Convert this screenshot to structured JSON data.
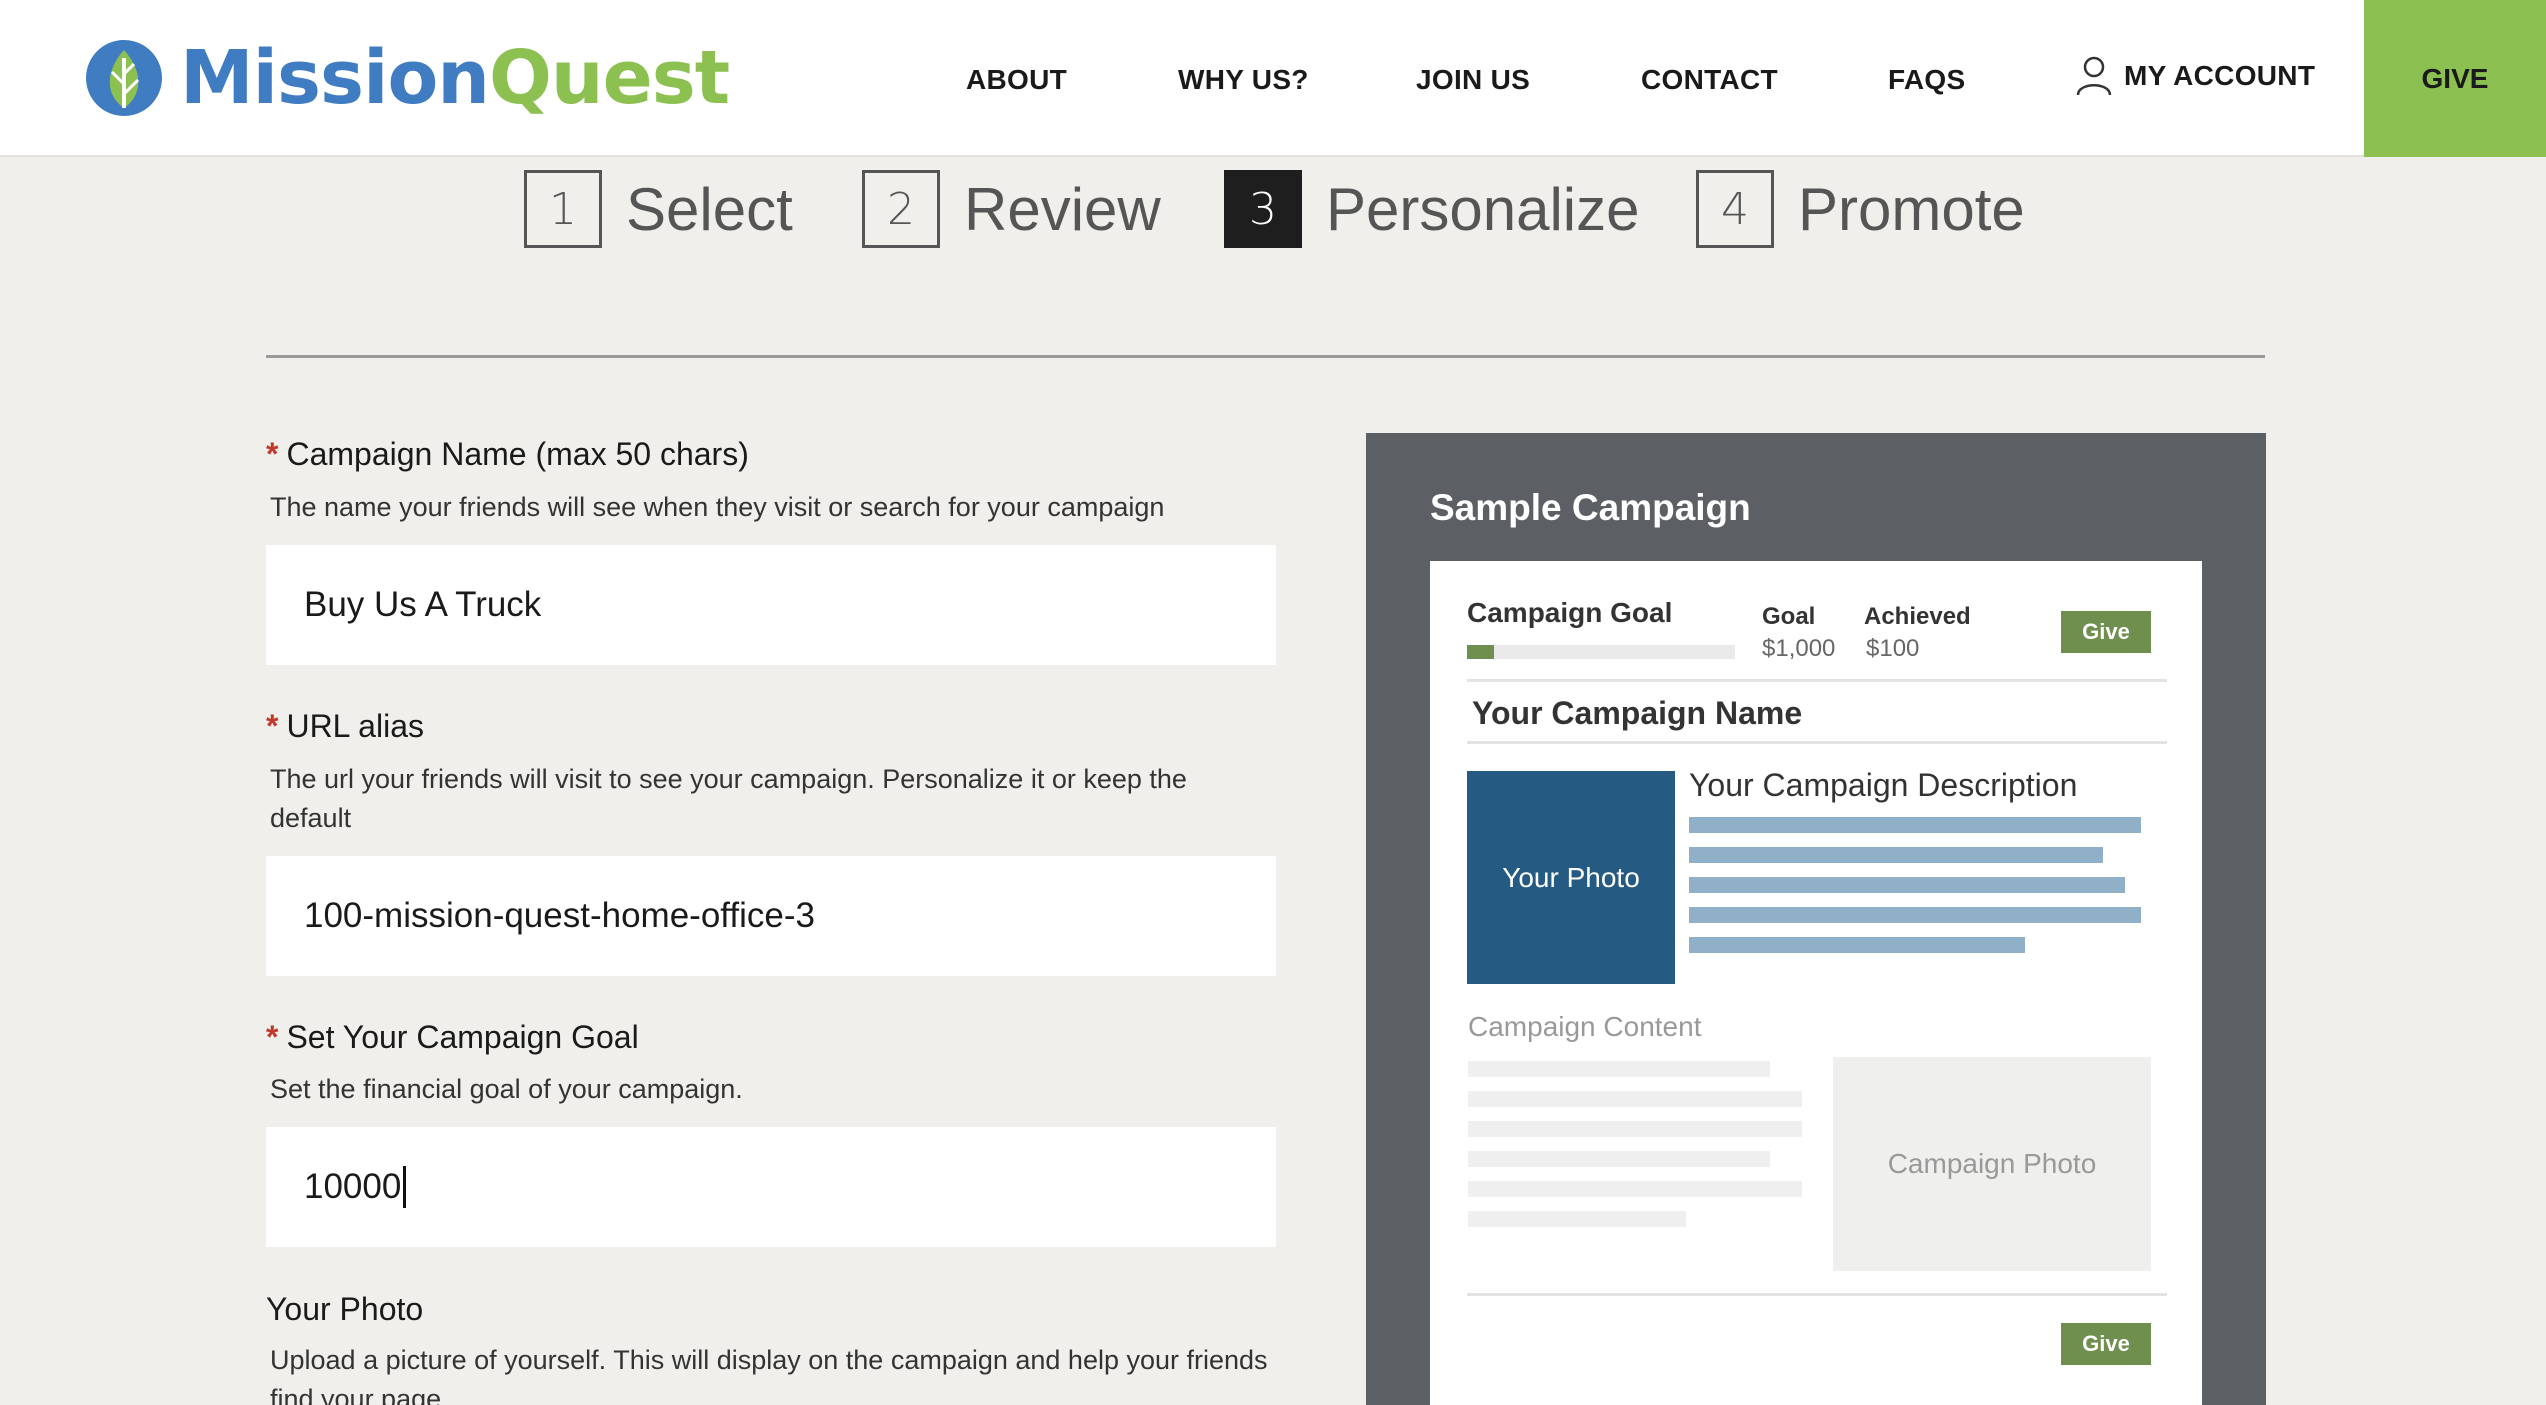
{
  "brand": {
    "part1": "Mission",
    "part2": "Quest",
    "colors": {
      "blue": "#3f7cc1",
      "green": "#8cc152"
    }
  },
  "nav": {
    "about": "ABOUT",
    "why_us": "WHY US?",
    "join_us": "JOIN US",
    "contact": "CONTACT",
    "faqs": "FAQS",
    "my_account": "MY ACCOUNT",
    "give": "GIVE"
  },
  "steps": [
    {
      "num": "1",
      "label": "Select",
      "active": false
    },
    {
      "num": "2",
      "label": "Review",
      "active": false
    },
    {
      "num": "3",
      "label": "Personalize",
      "active": true
    },
    {
      "num": "4",
      "label": "Promote",
      "active": false
    }
  ],
  "form": {
    "campaign_name": {
      "label": "Campaign Name (max 50 chars)",
      "help": "The name your friends will see when they visit or search for your campaign",
      "value": "Buy Us A Truck"
    },
    "url_alias": {
      "label": "URL alias",
      "help": "The url your friends will visit to see your campaign. Personalize it or keep the default",
      "value": "100-mission-quest-home-office-3"
    },
    "goal": {
      "label": "Set Your Campaign Goal",
      "help": "Set the financial goal of your campaign.",
      "value": "10000"
    },
    "photo": {
      "label": "Your Photo",
      "help": "Upload a picture of yourself. This will display on the campaign and help your friends find your page."
    },
    "required_mark": "*"
  },
  "sample": {
    "title": "Sample Campaign",
    "goal_heading": "Campaign Goal",
    "goal_progress_fraction": 0.1,
    "goal_label": "Goal",
    "goal_value": "$1,000",
    "achieved_label": "Achieved",
    "achieved_value": "$100",
    "give": "Give",
    "campaign_name": "Your Campaign Name",
    "photo": "Your Photo",
    "description": "Your Campaign Description",
    "content": "Campaign Content",
    "campaign_photo": "Campaign Photo"
  }
}
